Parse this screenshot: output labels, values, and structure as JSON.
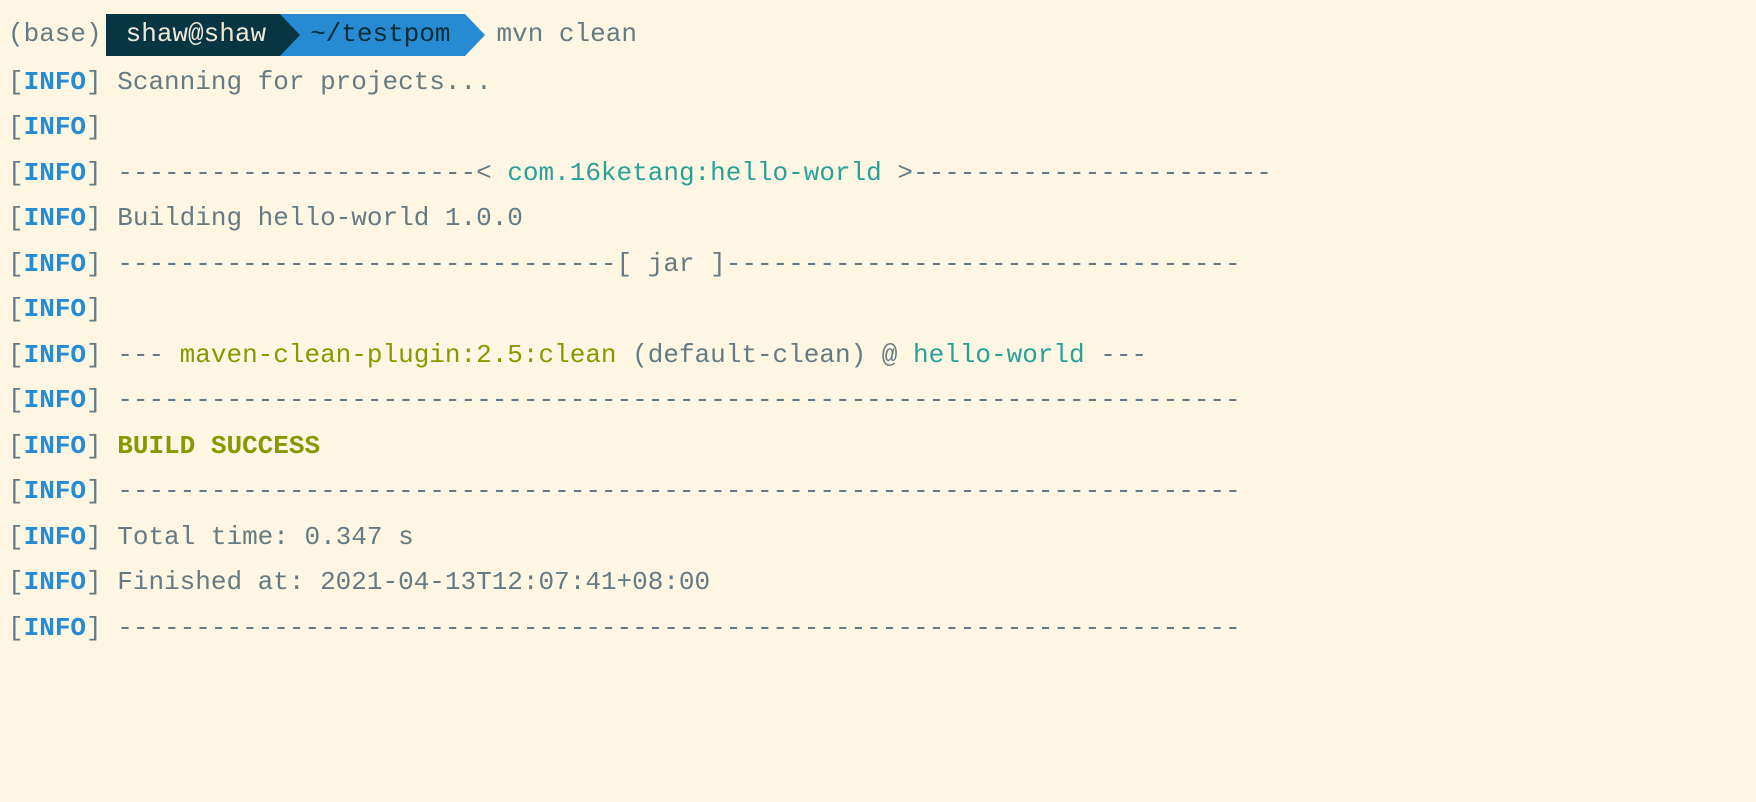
{
  "prompt": {
    "env": "(base)",
    "user": "shaw@shaw",
    "path": "~/testpom",
    "command": "mvn clean"
  },
  "tag": {
    "open": "[",
    "info": "INFO",
    "close": "]"
  },
  "lines": {
    "scan": " Scanning for projects...",
    "empty": "",
    "dash_pre_artifact": " -----------------------< ",
    "artifact": "com.16ketang:hello-world",
    "dash_post_artifact": " >-----------------------",
    "building": " Building hello-world 1.0.0",
    "jar_line": " --------------------------------[ jar ]---------------------------------",
    "plugin_pre": " --- ",
    "plugin_name": "maven-clean-plugin:2.5:clean",
    "plugin_mid": " (default-clean) @ ",
    "plugin_target": "hello-world",
    "plugin_post": " ---",
    "hr": " ------------------------------------------------------------------------",
    "success": " BUILD SUCCESS",
    "total_time": " Total time:  0.347 s",
    "finished": " Finished at: 2021-04-13T12:07:41+08:00"
  }
}
